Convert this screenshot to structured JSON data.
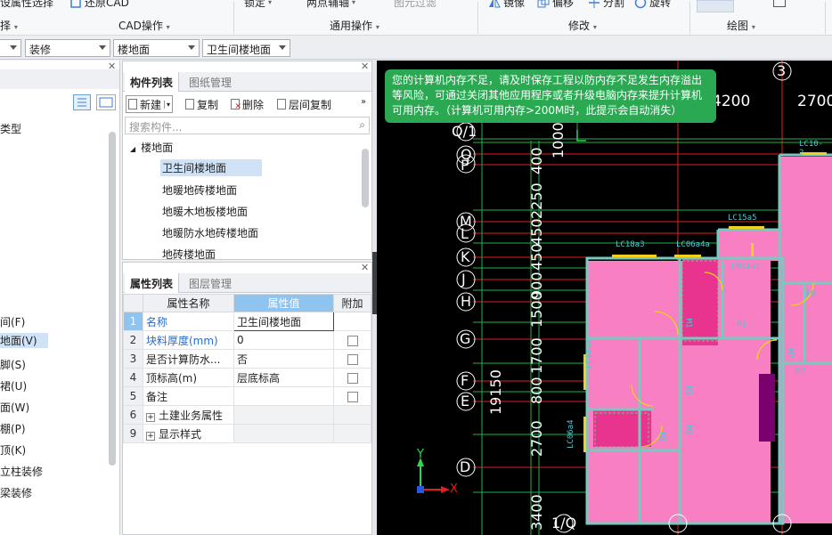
{
  "ribbon": {
    "items": {
      "attr_select": "设属性选择",
      "restore_cad": "还原CAD",
      "lock": "锁定",
      "grip_edit": "两点辅轴",
      "elem_filter": "图元过滤",
      "mirror": "镜像",
      "offset": "偏移",
      "split": "分割",
      "rotate": "旋转"
    },
    "groups": {
      "partial": "择",
      "cad_ops": "CAD操作",
      "common_ops": "通用操作",
      "modify": "修改",
      "draw": "绘图"
    }
  },
  "selectors": {
    "floor": "",
    "category": "装修",
    "type": "楼地面",
    "component": "卫生间楼地面"
  },
  "left_panel": {
    "items": [
      {
        "label": "类型"
      },
      {
        "label": "间(F)"
      },
      {
        "label": "地面(V)",
        "selected": true
      },
      {
        "label": "脚(S)"
      },
      {
        "label": "裙(U)"
      },
      {
        "label": "面(W)"
      },
      {
        "label": "棚(P)"
      },
      {
        "label": "顶(K)"
      },
      {
        "label": "立柱装修"
      },
      {
        "label": "梁装修"
      }
    ]
  },
  "component_panel": {
    "tabs": {
      "list": "构件列表",
      "drawing": "图纸管理"
    },
    "toolbar": {
      "new": "新建",
      "copy": "复制",
      "delete": "删除",
      "floor_copy": "层间复制"
    },
    "search_placeholder": "搜索构件...",
    "tree": {
      "root": "楼地面",
      "children": [
        {
          "label": "卫生间楼地面",
          "selected": true
        },
        {
          "label": "地暖地砖楼地面"
        },
        {
          "label": "地暖木地板楼地面"
        },
        {
          "label": "地暖防水地砖楼地面"
        },
        {
          "label": "地砖楼地面"
        }
      ]
    }
  },
  "props_panel": {
    "tabs": {
      "list": "属性列表",
      "layers": "图层管理"
    },
    "headers": {
      "name": "属性名称",
      "value": "属性值",
      "extra": "附加"
    },
    "rows": [
      {
        "num": "1",
        "name": "名称",
        "value": "卫生间楼地面",
        "blue": true,
        "checkbox": false,
        "selected": true
      },
      {
        "num": "2",
        "name": "块料厚度(mm)",
        "value": "0",
        "blue": true,
        "checkbox": true
      },
      {
        "num": "3",
        "name": "是否计算防水...",
        "value": "否",
        "blue": false,
        "checkbox": true
      },
      {
        "num": "4",
        "name": "顶标高(m)",
        "value": "层底标高",
        "blue": false,
        "checkbox": true
      },
      {
        "num": "5",
        "name": "备注",
        "value": "",
        "blue": false,
        "checkbox": true
      },
      {
        "num": "6",
        "name": "土建业务属性",
        "value": "",
        "group": true
      },
      {
        "num": "9",
        "name": "显示样式",
        "value": "",
        "group": true
      }
    ]
  },
  "canvas": {
    "toast": "您的计算机内存不足，请及时保存工程以防内存不足发生内存溢出等风险，可通过关闭其他应用程序或者升级电脑内存来提升计算机可用内存。（计算机可用内存>200M时，此提示会自动消失）",
    "axis_rows": [
      "Q/1",
      "Q",
      "P",
      "M",
      "L",
      "K",
      "J",
      "H",
      "G",
      "F",
      "E",
      "D",
      "1/Q"
    ],
    "axis_cols": [
      "3"
    ],
    "dims_vertical": [
      "1000",
      "2250",
      "400",
      "450",
      "450",
      "1500",
      "900",
      "900",
      "1700",
      "800",
      "19150",
      "2700",
      "3400"
    ],
    "dims_horizontal": [
      "4200",
      "2700"
    ],
    "labels": [
      "LC10-2",
      "LC15a5",
      "LC18a3",
      "LC06a4a",
      "LM14a1",
      "M1",
      "M3",
      "FM",
      "M7",
      "M7",
      "LC14a4",
      "M1",
      "LC06a4",
      "M2",
      "M1"
    ],
    "ucs": {
      "x": "X",
      "y": "Y"
    }
  },
  "colors": {
    "toast_bg": "#2aa952",
    "room_fill": "#f77fc2",
    "axis_line": "#e0201e",
    "wall": "#79c9c0",
    "selection_hl": "#cfe2f6",
    "header_hl": "#8fc3f0"
  }
}
